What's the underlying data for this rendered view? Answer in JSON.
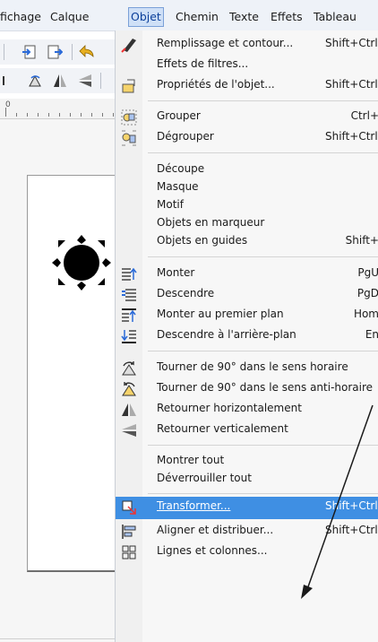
{
  "menubar": {
    "items": [
      {
        "label": "fichage"
      },
      {
        "label": "Calque"
      },
      {
        "label": "Objet"
      },
      {
        "label": "Chemin"
      },
      {
        "label": "Texte"
      },
      {
        "label": "Effets"
      },
      {
        "label": "Tableau"
      }
    ]
  },
  "ruler": {
    "zero_label": "0"
  },
  "objet_menu": {
    "items": [
      {
        "label": "Remplissage et contour...",
        "shortcut": "Shift+Ctrl+"
      },
      {
        "label": "Effets de filtres...",
        "shortcut": ""
      },
      {
        "label": "Propriétés de l'objet...",
        "shortcut": "Shift+Ctrl+"
      },
      {
        "label": "Grouper",
        "shortcut": "Ctrl+"
      },
      {
        "label": "Dégrouper",
        "shortcut": "Shift+Ctrl+"
      },
      {
        "label": "Découpe",
        "shortcut": ""
      },
      {
        "label": "Masque",
        "shortcut": ""
      },
      {
        "label": "Motif",
        "shortcut": ""
      },
      {
        "label": "Objets en marqueur",
        "shortcut": ""
      },
      {
        "label": "Objets en guides",
        "shortcut": "Shift+"
      },
      {
        "label": "Monter",
        "shortcut": "PgU"
      },
      {
        "label": "Descendre",
        "shortcut": "PgD"
      },
      {
        "label": "Monter au premier plan",
        "shortcut": "Hom"
      },
      {
        "label": "Descendre à l'arrière-plan",
        "shortcut": "En"
      },
      {
        "label": "Tourner de 90° dans le sens horaire",
        "shortcut": ""
      },
      {
        "label": "Tourner de 90° dans le sens anti-horaire",
        "shortcut": ""
      },
      {
        "label": "Retourner horizontalement",
        "shortcut": ""
      },
      {
        "label": "Retourner verticalement",
        "shortcut": ""
      },
      {
        "label": "Montrer tout",
        "shortcut": ""
      },
      {
        "label": "Déverrouiller tout",
        "shortcut": ""
      },
      {
        "label": "Transformer...",
        "shortcut": "Shift+Ctrl+"
      },
      {
        "label": "Aligner et distribuer...",
        "shortcut": "Shift+Ctrl+"
      },
      {
        "label": "Lignes et colonnes...",
        "shortcut": ""
      }
    ]
  },
  "colors": {
    "menubar_bg": "#eef2f8",
    "menu_bg": "#f7f7f7",
    "highlight": "#3f8fe3",
    "active_menu_bg": "#cfe0f7"
  }
}
